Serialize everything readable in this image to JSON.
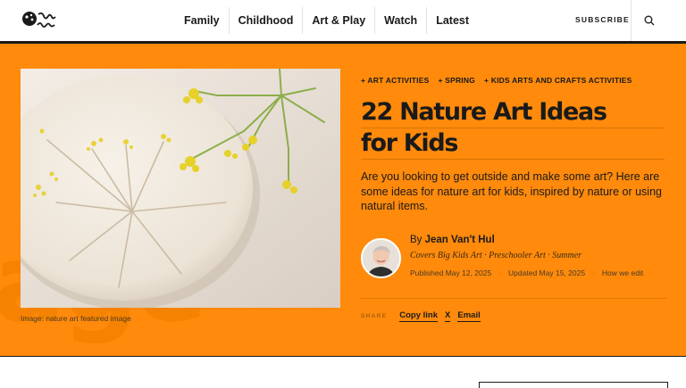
{
  "header": {
    "logo_alt": "artful age",
    "nav": [
      "Family",
      "Childhood",
      "Art & Play",
      "Watch",
      "Latest"
    ],
    "subscribe_label": "SUBSCRIBE",
    "search_icon": "search-icon"
  },
  "hero": {
    "ghost_text": "age",
    "image_caption": "Image: nature art featured image",
    "tags": [
      "+ ART ACTIVITIES",
      "+ SPRING",
      "+ KIDS ARTS AND CRAFTS ACTIVITIES"
    ],
    "title_line1": "22 Nature Art Ideas",
    "title_line2": "for Kids",
    "dek": "Are you looking to get outside and make some art? Here are some ideas for nature art for kids, inspired by nature or using natural items.",
    "author": {
      "by_prefix": "By",
      "name": "Jean Van't Hul",
      "covers": "Covers Big Kids Art · Preschooler Art · Summer"
    },
    "dates": {
      "published": "Published May 12, 2025",
      "updated": "Updated May 15, 2025",
      "edit_link": "How we edit",
      "separator": "·"
    },
    "share": {
      "label": "SHARE",
      "links": [
        "Copy link",
        "X",
        "Email"
      ]
    }
  },
  "colors": {
    "hero_background": "#ff8a0c",
    "text": "#1a1a1a",
    "header_background": "#ffffff"
  }
}
